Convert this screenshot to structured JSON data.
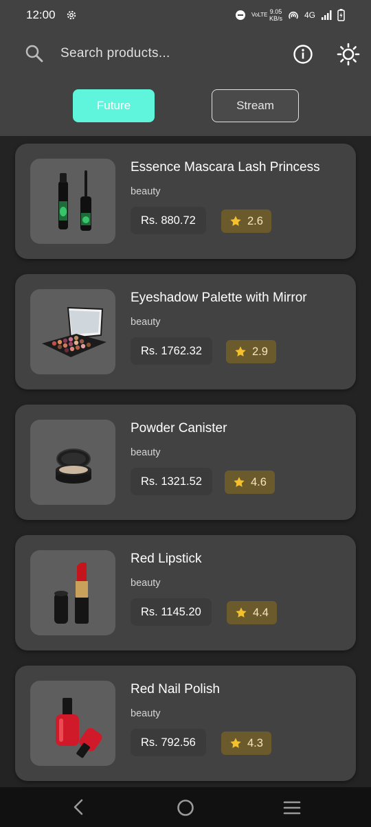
{
  "status_bar": {
    "time": "12:00",
    "network_speed_value": "9.05",
    "network_speed_unit": "KB/s",
    "network_type": "4G",
    "volte_label": "VoLTE"
  },
  "header": {
    "search_placeholder": "Search products...",
    "tabs": [
      {
        "label": "Future",
        "active": true
      },
      {
        "label": "Stream",
        "active": false
      }
    ]
  },
  "colors": {
    "accent": "#5ff5dd",
    "background": "#232323",
    "card": "#424242",
    "rating_bg": "#6b5a2c",
    "star": "#f5c02e"
  },
  "products": [
    {
      "title": "Essence Mascara Lash Princess",
      "category": "beauty",
      "price": "Rs. 880.72",
      "rating": "2.6",
      "image_icon": "mascara-image"
    },
    {
      "title": "Eyeshadow Palette with Mirror",
      "category": "beauty",
      "price": "Rs. 1762.32",
      "rating": "2.9",
      "image_icon": "eyeshadow-palette-image"
    },
    {
      "title": "Powder Canister",
      "category": "beauty",
      "price": "Rs. 1321.52",
      "rating": "4.6",
      "image_icon": "powder-canister-image"
    },
    {
      "title": "Red Lipstick",
      "category": "beauty",
      "price": "Rs. 1145.20",
      "rating": "4.4",
      "image_icon": "lipstick-image"
    },
    {
      "title": "Red Nail Polish",
      "category": "beauty",
      "price": "Rs. 792.56",
      "rating": "4.3",
      "image_icon": "nail-polish-image"
    }
  ]
}
